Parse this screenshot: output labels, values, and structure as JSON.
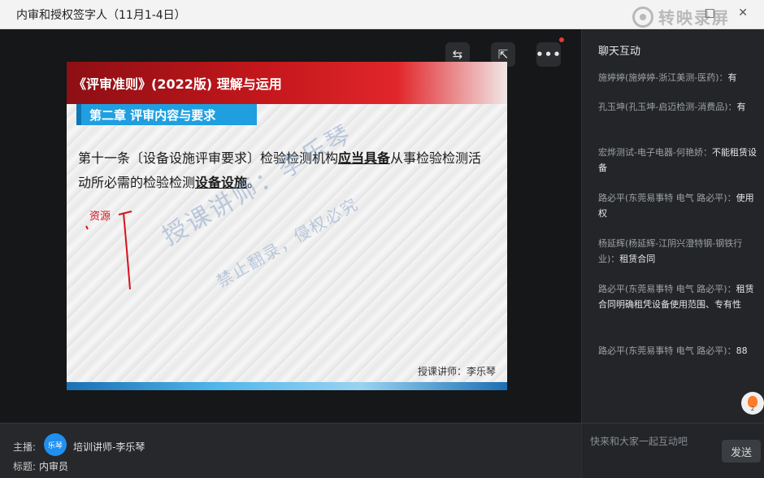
{
  "window": {
    "title": "内审和授权签字人（11月1-4日）",
    "controls": "□ ✕"
  },
  "recorder_watermark": {
    "text": "转映录屏"
  },
  "video_controls": {
    "b1_icon": "⇆",
    "b2_icon": "⇱",
    "b3_icon": "•••"
  },
  "slide": {
    "header_title": "《评审准则》(2022版) 理解与运用",
    "chapter_title": "第二章  评审内容与要求",
    "body_plain_1": "第十一条〔设备设施评审要求〕检验检测机构",
    "body_bold_1": "应当具备",
    "body_plain_2": "从事检验检测活动所必需的检验检测",
    "body_bold_2": "设备设施",
    "body_plain_3": "。",
    "annotation": "资源",
    "watermark_1": "授课讲师：李乐琴",
    "watermark_2": "禁止翻录，侵权必究",
    "lecturer": "授课讲师：李乐琴"
  },
  "host": {
    "label": "主播:",
    "avatar": "乐琴",
    "name": "培训讲师-李乐琴",
    "topic_label": "标题:",
    "topic": "内审员"
  },
  "chat": {
    "title": "聊天互动",
    "messages": [
      {
        "user": "施婷婷(施婷婷-浙江美测-医药)：",
        "text": "有"
      },
      {
        "user": "孔玉坤(孔玉坤-启迈检测-消费品)：",
        "text": "有"
      },
      {
        "user": "宏烨测试-电子电器-何艳娇：",
        "text": "不能租赁设备"
      },
      {
        "user": "路必平(东莞易事特 电气 路必平)：",
        "text": "使用权"
      },
      {
        "user": "杨延辉(杨延辉-江阴兴澄特钢-钢铁行业)：",
        "text": "租赁合同"
      },
      {
        "user": "路必平(东莞易事特 电气 路必平)：",
        "text": "租赁合同明确租凭设备使用范围、专有性"
      },
      {
        "user": "路必平(东莞易事特 电气 路必平)：",
        "text": "88"
      }
    ],
    "like_count": "2",
    "input_placeholder": "快来和大家一起互动吧",
    "send_label": "发送"
  }
}
